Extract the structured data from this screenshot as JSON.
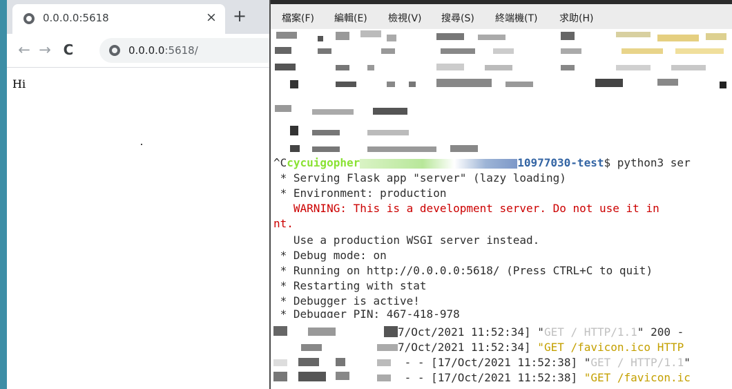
{
  "browser": {
    "tab": {
      "title": "0.0.0.0:5618",
      "close_icon": "×"
    },
    "new_tab_icon": "+",
    "toolbar": {
      "back_icon": "←",
      "forward_icon": "→",
      "reload_icon": "C"
    },
    "address": {
      "host": "0.0.0.0",
      "path": ":5618/"
    },
    "page": {
      "text": "Hi"
    }
  },
  "terminal": {
    "menu": [
      "檔案(F)",
      "編輯(E)",
      "檢視(V)",
      "搜尋(S)",
      "終端機(T)",
      "求助(H)"
    ],
    "prompt": {
      "prefix": "^C",
      "user": "cycuigopher",
      "dir": "10977030-test",
      "cmd": "$ python3 ser"
    },
    "lines": [
      " * Serving Flask app \"server\" (lazy loading)",
      " * Environment: production",
      "   WARNING: This is a development server. Do not use it in",
      "nt.",
      "   Use a production WSGI server instead.",
      " * Debug mode: on",
      " * Running on http://0.0.0.0:5618/ (Press CTRL+C to quit)",
      " * Restarting with stat",
      " * Debugger is active!",
      " * Debugger PIN: 467-418-978"
    ],
    "log": [
      {
        "ts": "7/Oct/2021 11:52:34] ",
        "q1": "\"",
        "req": "GET / HTTP/1.1",
        "q2": "\"",
        "rest": " 200 -"
      },
      {
        "ts": "7/Oct/2021 11:52:34] ",
        "q1": "\"",
        "req": "GET /favicon.ico HTTP",
        "q2": "",
        "rest": ""
      },
      {
        "ts": " - - [17/Oct/2021 11:52:38] ",
        "q1": "\"",
        "req": "GET / HTTP/1.1",
        "q2": "\"",
        "rest": ""
      },
      {
        "ts": " - - [17/Oct/2021 11:52:38] ",
        "q1": "\"",
        "req": "GET /favicon.ic",
        "q2": "",
        "rest": ""
      }
    ]
  },
  "colors": {
    "desktop": "#3d8ea6",
    "prompt_user": "#8ae234",
    "prompt_dir": "#3465a4",
    "warning": "#cc0000",
    "log_request": "#c4a000"
  }
}
